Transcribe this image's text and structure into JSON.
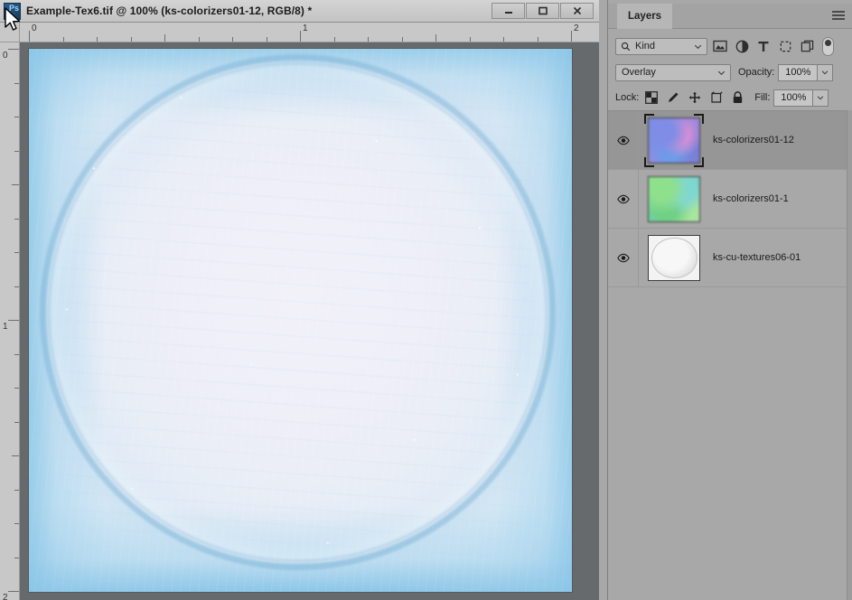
{
  "window": {
    "title": "Example-Tex6.tif @ 100% (ks-colorizers01-12, RGB/8) *",
    "app_icon_text": "Ps",
    "minimize_label": "Minimize",
    "maximize_label": "Maximize",
    "close_label": "Close"
  },
  "rulers": {
    "horizontal_labels": [
      "0",
      "1",
      "2"
    ],
    "vertical_labels": [
      "0",
      "1",
      "2"
    ],
    "unit": "inches"
  },
  "canvas": {
    "document_name": "Example-Tex6.tif",
    "zoom": "100%",
    "color_mode": "RGB/8",
    "active_layer": "ks-colorizers01-12",
    "unsaved_marker": "*"
  },
  "panel": {
    "tab_label": "Layers",
    "menu_icon": "hamburger-menu-icon",
    "filter": {
      "search_icon": "search-icon",
      "kind_label": "Kind",
      "caret_icon": "chevron-down-icon",
      "icons": [
        "pixel-layer-filter-icon",
        "adjustment-layer-filter-icon",
        "type-layer-filter-icon",
        "shape-layer-filter-icon",
        "smart-object-filter-icon"
      ],
      "toggle_icon": "filter-enable-toggle"
    },
    "blend": {
      "mode": "Overlay",
      "opacity_label": "Opacity:",
      "opacity_value": "100%"
    },
    "lock": {
      "label": "Lock:",
      "icons": [
        "lock-transparent-pixels-icon",
        "lock-image-pixels-icon",
        "lock-position-icon",
        "lock-artboard-nesting-icon",
        "lock-all-icon"
      ],
      "fill_label": "Fill:",
      "fill_value": "100%"
    },
    "layers": [
      {
        "name": "ks-colorizers01-12",
        "visible": true,
        "selected": true,
        "thumb": "thumb-a",
        "eye_icon": "eye-icon"
      },
      {
        "name": "ks-colorizers01-1",
        "visible": true,
        "selected": false,
        "thumb": "thumb-b",
        "eye_icon": "eye-icon"
      },
      {
        "name": "ks-cu-textures06-01",
        "visible": true,
        "selected": false,
        "thumb": "thumb-c",
        "eye_icon": "eye-icon"
      }
    ]
  },
  "colors": {
    "chrome": "#a8a8a8",
    "titlebar": "#c9c9c9",
    "workspace": "#666a6d",
    "selected_row": "#969696",
    "text": "#1b1b1b"
  },
  "cursor": {
    "icon": "mouse-pointer-arrow"
  }
}
